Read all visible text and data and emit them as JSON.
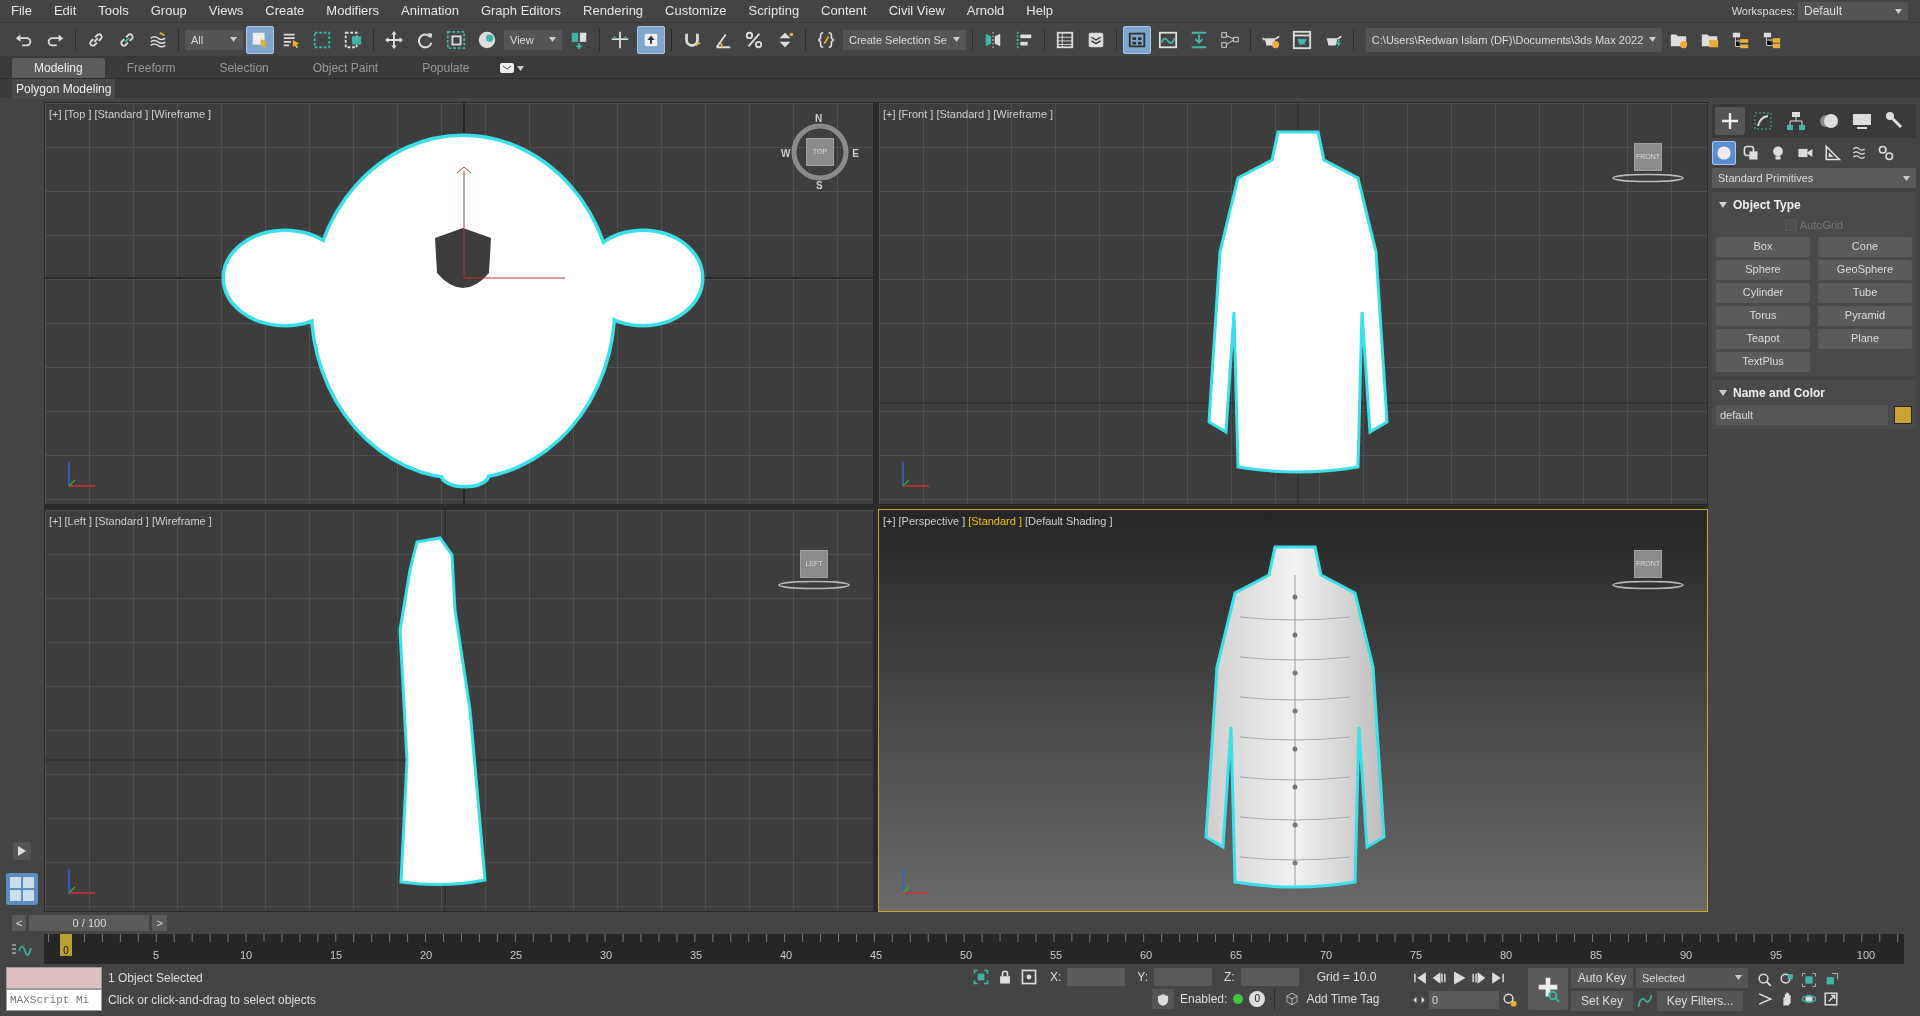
{
  "menu": [
    "File",
    "Edit",
    "Tools",
    "Group",
    "Views",
    "Create",
    "Modifiers",
    "Animation",
    "Graph Editors",
    "Rendering",
    "Customize",
    "Scripting",
    "Content",
    "Civil View",
    "Arnold",
    "Help"
  ],
  "workspaces": {
    "label": "Workspaces:",
    "value": "Default"
  },
  "toolbar": [
    {
      "kind": "icon",
      "selected": false
    },
    {
      "kind": "icon",
      "selected": false
    },
    {
      "kind": "sep"
    },
    {
      "kind": "icon",
      "selected": false
    },
    {
      "kind": "icon",
      "selected": false
    },
    {
      "kind": "icon",
      "selected": false
    },
    {
      "kind": "sep"
    },
    {
      "kind": "dropdown",
      "value": "All"
    },
    {
      "kind": "icon",
      "selected": true
    },
    {
      "kind": "icon",
      "selected": false
    },
    {
      "kind": "icon",
      "selected": false
    },
    {
      "kind": "icon",
      "selected": false
    },
    {
      "kind": "sep"
    },
    {
      "kind": "icon",
      "selected": false
    },
    {
      "kind": "icon",
      "selected": false
    },
    {
      "kind": "icon",
      "selected": false
    },
    {
      "kind": "icon",
      "selected": false
    },
    {
      "kind": "dropdown",
      "value": "View"
    },
    {
      "kind": "icon",
      "selected": false
    },
    {
      "kind": "sep"
    },
    {
      "kind": "icon",
      "selected": false
    },
    {
      "kind": "icon",
      "selected": true
    },
    {
      "kind": "sep"
    },
    {
      "kind": "icon",
      "selected": false
    },
    {
      "kind": "icon",
      "selected": false
    },
    {
      "kind": "icon",
      "selected": false
    },
    {
      "kind": "icon",
      "selected": false
    },
    {
      "kind": "sep"
    },
    {
      "kind": "icon",
      "selected": false
    },
    {
      "kind": "dropdown",
      "value": "Create Selection Se"
    },
    {
      "kind": "sep"
    },
    {
      "kind": "icon",
      "selected": false
    },
    {
      "kind": "icon",
      "selected": false
    },
    {
      "kind": "sep"
    },
    {
      "kind": "icon",
      "selected": false
    },
    {
      "kind": "icon",
      "selected": false
    },
    {
      "kind": "sep"
    },
    {
      "kind": "icon",
      "selected": true
    },
    {
      "kind": "icon",
      "selected": false
    },
    {
      "kind": "icon",
      "selected": false
    },
    {
      "kind": "icon",
      "selected": false
    },
    {
      "kind": "sep"
    },
    {
      "kind": "icon",
      "selected": false
    },
    {
      "kind": "icon",
      "selected": false
    },
    {
      "kind": "icon",
      "selected": false
    },
    {
      "kind": "sep"
    },
    {
      "kind": "path",
      "value": "C:\\Users\\Redwan Islam (DF)\\Documents\\3ds Max 2022"
    },
    {
      "kind": "icon",
      "selected": false
    },
    {
      "kind": "icon",
      "selected": false
    },
    {
      "kind": "icon",
      "selected": false
    },
    {
      "kind": "icon",
      "selected": false
    }
  ],
  "ribbon": {
    "tabs": [
      {
        "label": "Modeling",
        "selected": true
      },
      {
        "label": "Freeform",
        "selected": false
      },
      {
        "label": "Selection",
        "selected": false
      },
      {
        "label": "Object Paint",
        "selected": false
      },
      {
        "label": "Populate",
        "selected": false
      }
    ],
    "panel": "Polygon Modeling"
  },
  "viewports": [
    {
      "kind": "top",
      "active": false,
      "labels": [
        {
          "text": "[+]",
          "highlighted": false
        },
        {
          "text": "[Top ]",
          "highlighted": false
        },
        {
          "text": "[Standard ]",
          "highlighted": false
        },
        {
          "text": "[Wireframe ]",
          "highlighted": false
        }
      ],
      "cube": "TOP",
      "compass": [
        "N",
        "E",
        "S",
        "W"
      ]
    },
    {
      "kind": "front",
      "active": false,
      "labels": [
        {
          "text": "[+]",
          "highlighted": false
        },
        {
          "text": "[Front ]",
          "highlighted": false
        },
        {
          "text": "[Standard ]",
          "highlighted": false
        },
        {
          "text": "[Wireframe ]",
          "highlighted": false
        }
      ],
      "cube": "FRONT"
    },
    {
      "kind": "left",
      "active": false,
      "labels": [
        {
          "text": "[+]",
          "highlighted": false
        },
        {
          "text": "[Left ]",
          "highlighted": false
        },
        {
          "text": "[Standard ]",
          "highlighted": false
        },
        {
          "text": "[Wireframe ]",
          "highlighted": false
        }
      ],
      "cube": "LEFT"
    },
    {
      "kind": "perspective",
      "active": true,
      "labels": [
        {
          "text": "[+]",
          "highlighted": false
        },
        {
          "text": "[Perspective ]",
          "highlighted": false
        },
        {
          "text": "[Standard ]",
          "highlighted": true
        },
        {
          "text": "[Default Shading ]",
          "highlighted": false
        }
      ],
      "cube": "FRONT"
    }
  ],
  "command_panel": {
    "tabs": [
      {
        "selected": true
      },
      {
        "selected": false
      },
      {
        "selected": false
      },
      {
        "selected": false
      },
      {
        "selected": false
      },
      {
        "selected": false
      }
    ],
    "categories": [
      {
        "selected": true
      },
      {
        "selected": false
      },
      {
        "selected": false
      },
      {
        "selected": false
      },
      {
        "selected": false
      },
      {
        "selected": false
      },
      {
        "selected": false
      }
    ],
    "dropdown": "Standard Primitives",
    "rollouts": [
      {
        "kind": "object_type",
        "title": "Object Type",
        "expanded": true,
        "autogrid": {
          "label": "AutoGrid",
          "checked": false,
          "disabled": true
        },
        "buttons": [
          "Box",
          "Cone",
          "Sphere",
          "GeoSphere",
          "Cylinder",
          "Tube",
          "Torus",
          "Pyramid",
          "Teapot",
          "Plane",
          "TextPlus"
        ]
      },
      {
        "kind": "name_color",
        "title": "Name and Color",
        "expanded": true,
        "name": "default",
        "color": "#c9a536"
      }
    ]
  },
  "time_slider": {
    "prev": "<",
    "thumb": "0 / 100",
    "next": ">",
    "level": 0
  },
  "time_ruler": {
    "marker": "0",
    "level": 0,
    "labels": [
      "5",
      "10",
      "15",
      "20",
      "25",
      "30",
      "35",
      "40",
      "45",
      "50",
      "55",
      "60",
      "65",
      "70",
      "75",
      "80",
      "85",
      "90",
      "95",
      "100"
    ]
  },
  "status": {
    "maxscript_placeholder": "MAXScript Mi",
    "selection": "1 Object Selected",
    "prompt": "Click or click-and-drag to select objects",
    "coord_labels": [
      "X:",
      "Y:",
      "Z:"
    ],
    "grid": "Grid = 10.0",
    "enabled_label": "Enabled:",
    "enabled": true,
    "tag_count": "0",
    "add_time_tag": "Add Time Tag"
  },
  "animation": {
    "frame": "0",
    "auto_key": "Auto Key",
    "key_set": "Selected",
    "set_key": "Set Key",
    "key_filters": "Key Filters..."
  }
}
